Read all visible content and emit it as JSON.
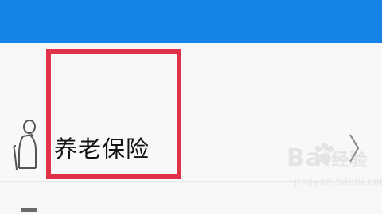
{
  "colors": {
    "top_bar": "#1684e6",
    "highlight": "#e0334a",
    "label": "#111111"
  },
  "list": {
    "items": [
      {
        "label": "养老保险",
        "icon": "elderly-person-icon",
        "trailing_icon": "chevron-right-icon"
      }
    ]
  },
  "watermark": {
    "brand": "Bai",
    "brand_suffix": "经验",
    "sub": "jingyan.baidu.com"
  }
}
